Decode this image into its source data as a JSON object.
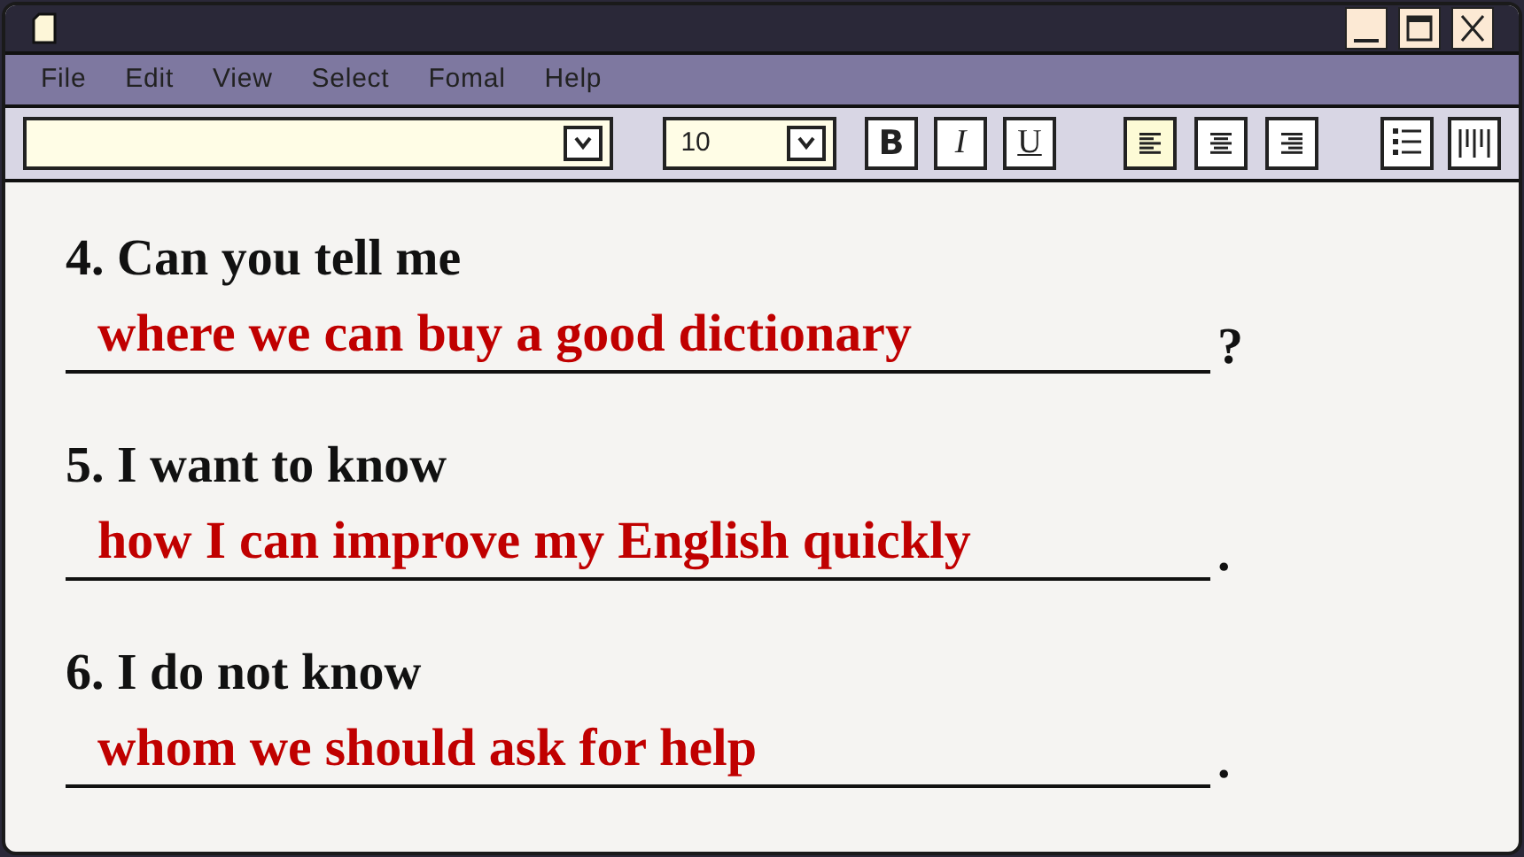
{
  "window": {
    "controls": [
      {
        "kind": "minimize"
      },
      {
        "kind": "maximize"
      },
      {
        "kind": "close"
      }
    ]
  },
  "menu": [
    "File",
    "Edit",
    "View",
    "Select",
    "Fomal",
    "Help"
  ],
  "toolbar": {
    "size_field": {
      "value": "10"
    },
    "format_buttons": [
      {
        "label": "B",
        "kind": "bold"
      },
      {
        "label": "I",
        "kind": "italic"
      },
      {
        "label": "U",
        "kind": "underline"
      }
    ],
    "align_buttons": [
      {
        "kind": "left",
        "selected": true
      },
      {
        "kind": "center",
        "selected": false
      },
      {
        "kind": "right",
        "selected": false
      }
    ],
    "list_buttons": [
      {
        "kind": "bullets"
      },
      {
        "kind": "columns"
      }
    ]
  },
  "questions": [
    {
      "prompt": "4. Can you tell me",
      "answer": "where we can buy a good dictionary",
      "end": "?"
    },
    {
      "prompt": "5. I want to know",
      "answer": "how I can improve my English quickly",
      "end": "."
    },
    {
      "prompt": "6. I do not know",
      "answer": "whom we should ask for help",
      "end": "."
    }
  ]
}
